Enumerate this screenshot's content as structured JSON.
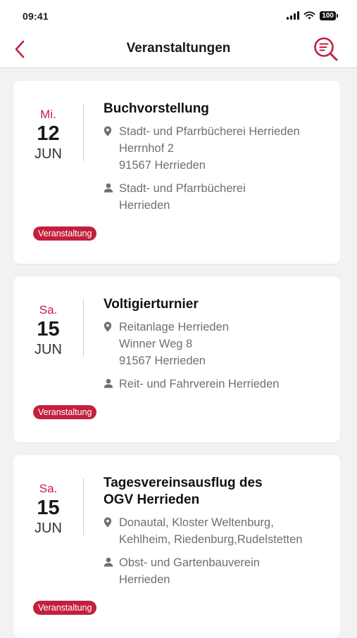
{
  "status_bar": {
    "time": "09:41",
    "battery": "100"
  },
  "header": {
    "title": "Veranstaltungen",
    "back_icon": "chevron-left-icon",
    "search_icon": "search-filter-icon"
  },
  "colors": {
    "accent": "#c3203e",
    "muted_text": "#6f6f6f",
    "background": "#f2f2f2"
  },
  "events": [
    {
      "day": "Mi.",
      "date": "12",
      "month": "JUN",
      "title": "Buchvorstellung",
      "location": [
        "Stadt- und Pfarrbücherei Herrieden",
        "Herrnhof 2",
        "91567 Herrieden"
      ],
      "organizer": [
        "Stadt- und Pfarrbücherei",
        "Herrieden"
      ],
      "badge": "Veranstaltung"
    },
    {
      "day": "Sa.",
      "date": "15",
      "month": "JUN",
      "title": "Voltigierturnier",
      "location": [
        "Reitanlage Herrieden",
        "Winner Weg 8",
        "91567 Herrieden"
      ],
      "organizer": [
        "Reit- und Fahrverein Herrieden"
      ],
      "badge": "Veranstaltung"
    },
    {
      "day": "Sa.",
      "date": "15",
      "month": "JUN",
      "title": "Tagesvereinsausflug des OGV Herrieden",
      "location": [
        "Donautal, Kloster Weltenburg,",
        "Kehlheim, Riedenburg,Rudelstetten"
      ],
      "organizer": [
        "Obst- und Gartenbauverein",
        "Herrieden"
      ],
      "badge": "Veranstaltung"
    }
  ]
}
